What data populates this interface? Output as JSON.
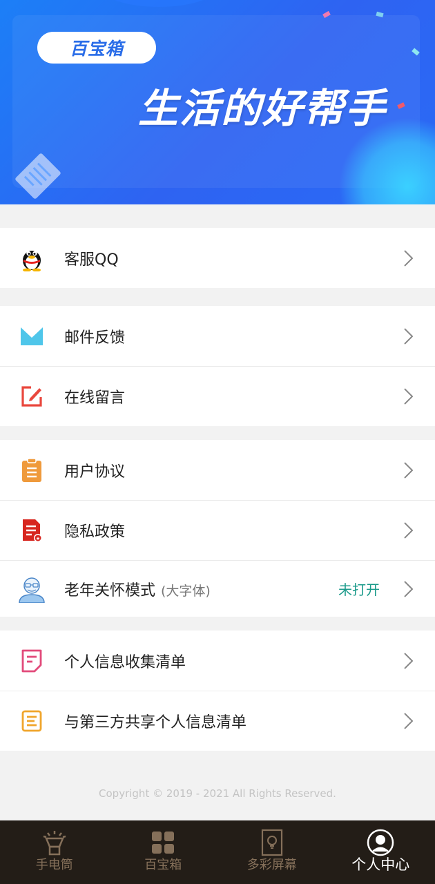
{
  "banner": {
    "pill_text": "百宝箱",
    "slogan": "生活的好帮手"
  },
  "menu": {
    "customer_qq": "客服QQ",
    "email_feedback": "邮件反馈",
    "online_message": "在线留言",
    "user_agreement": "用户协议",
    "privacy_policy": "隐私政策",
    "elder_mode": "老年关怀模式",
    "elder_mode_sub": "(大字体)",
    "elder_mode_status": "未打开",
    "personal_info_list": "个人信息收集清单",
    "third_party_list": "与第三方共享个人信息清单"
  },
  "copyright": "Copyright © 2019 - 2021 All Rights Reserved.",
  "tabs": {
    "flashlight": "手电筒",
    "toolbox": "百宝箱",
    "colorful_screen": "多彩屏幕",
    "personal_center": "个人中心"
  },
  "colors": {
    "banner_blue": "#2e63f2",
    "status_green": "#1a9a8a",
    "tabbar_bg": "#231d17",
    "tab_inactive": "#85705a",
    "tab_active": "#ffffff"
  }
}
